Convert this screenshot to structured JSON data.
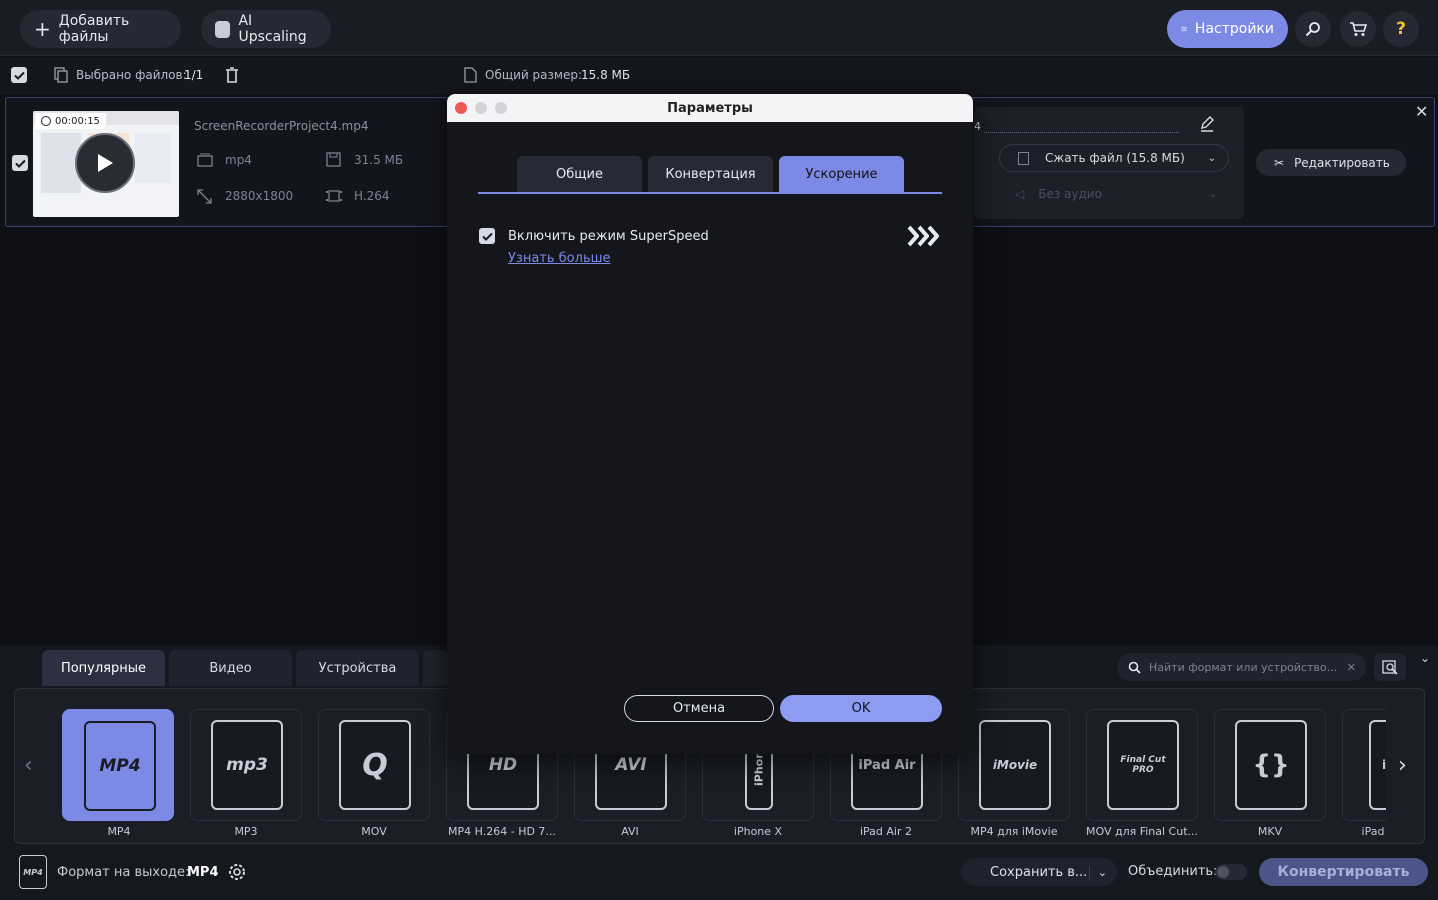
{
  "toolbar": {
    "add_files": "Добавить файлы",
    "ai_upscaling": "AI Upscaling",
    "settings": "Настройки"
  },
  "selection": {
    "selected_label": "Выбрано файлов:",
    "selected_value": "1/1",
    "total_label": "Общий размер:",
    "total_value": "15.8 МБ"
  },
  "file": {
    "duration": "00:00:15",
    "name": "ScreenRecorderProject4.mp4",
    "format": "mp4",
    "size": "31.5 МБ",
    "resolution": "2880x1800",
    "codec": "H.264",
    "output_prefix": "4",
    "compress": "Сжать файл (15.8 МБ)",
    "audio": "Без аудио",
    "edit": "Редактировать"
  },
  "dialog": {
    "title": "Параметры",
    "tabs": [
      "Общие",
      "Конвертация",
      "Ускорение"
    ],
    "active_tab": "Ускорение",
    "superspeed_label": "Включить режим SuperSpeed",
    "superspeed_checked": true,
    "learn_more": "Узнать больше",
    "cancel": "Отмена",
    "ok": "OK"
  },
  "bottom": {
    "tabs": [
      "Популярные",
      "Видео",
      "Устройства"
    ],
    "search_placeholder": "Найти формат или устройство...",
    "formats": [
      {
        "label": "MP4",
        "icon": "MP4",
        "selected": true
      },
      {
        "label": "MP3",
        "icon": "mp3"
      },
      {
        "label": "MOV",
        "icon": "Q"
      },
      {
        "label": "MP4 H.264 - HD 7...",
        "icon": "HD"
      },
      {
        "label": "AVI",
        "icon": "AVI"
      },
      {
        "label": "iPhone X",
        "icon": "iPhone"
      },
      {
        "label": "iPad Air 2",
        "icon": "iPad Air"
      },
      {
        "label": "MP4 для iMovie",
        "icon": "iMovie"
      },
      {
        "label": "MOV для Final Cut...",
        "icon": "Final Cut PRO"
      },
      {
        "label": "MKV",
        "icon": "{}"
      },
      {
        "label": "iPad",
        "icon": "i"
      }
    ],
    "output_label": "Формат на выходе:",
    "output_value": "MP4",
    "save_to": "Сохранить в...",
    "merge": "Объединить:",
    "convert": "Конвертировать"
  },
  "colors": {
    "accent": "#7c8ae6",
    "background": "#101116"
  }
}
